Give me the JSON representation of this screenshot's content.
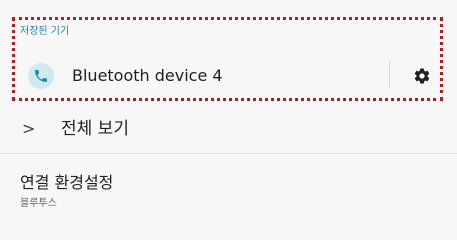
{
  "saved_devices": {
    "header": "저장된 기기",
    "device": {
      "name": "Bluetooth device 4",
      "icon": "phone-icon",
      "settings_icon": "gear-icon"
    }
  },
  "view_all": {
    "icon": "chevron-right-icon",
    "chevron_glyph": ">",
    "label": "전체 보기"
  },
  "connection_preferences": {
    "title": "연결 환경설정",
    "subtitle": "블루투스"
  },
  "colors": {
    "accent": "#2f7fa8",
    "icon_bg": "#cfe9f2",
    "highlight_border": "#b51b1b"
  }
}
